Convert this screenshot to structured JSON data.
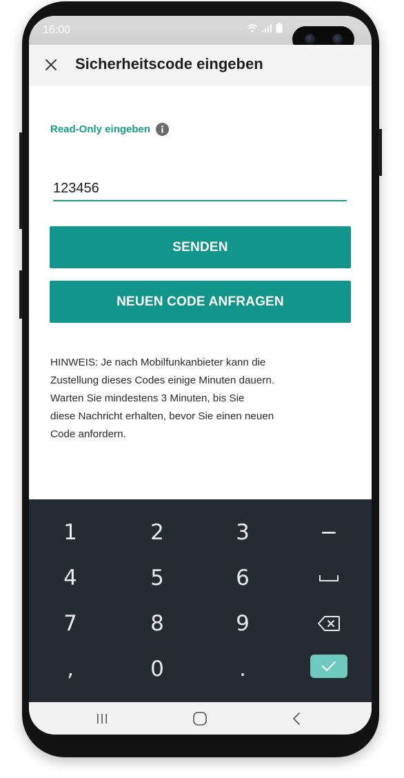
{
  "status_bar": {
    "time": "16:00",
    "icons": [
      "wifi-icon",
      "signal-icon",
      "battery-icon"
    ]
  },
  "app_bar": {
    "close_icon": "close-icon",
    "title": "Sicherheitscode eingeben"
  },
  "form": {
    "label": "Read-Only eingeben",
    "info_icon": "info-icon",
    "code_value": "123456",
    "send_label": "SENDEN",
    "new_code_label": "NEUEN CODE ANFRAGEN"
  },
  "note": {
    "lines": [
      "HINWEIS: Je nach Mobilfunkanbieter kann die",
      "Zustellung dieses Codes einige Minuten dauern.",
      "Warten Sie mindestens 3 Minuten, bis Sie",
      "diese Nachricht erhalten, bevor Sie einen neuen",
      "Code anfordern."
    ]
  },
  "keyboard": {
    "keys": [
      "1",
      "2",
      "3",
      "−",
      "4",
      "5",
      "6",
      "␣",
      "7",
      "8",
      "9",
      "⌫",
      ",",
      "0",
      ".",
      "✓"
    ],
    "key_icons": {
      "space": "space-icon",
      "backspace": "backspace-icon",
      "done": "check-icon"
    }
  },
  "nav_bar": {
    "icons": [
      "recent-apps-icon",
      "home-icon",
      "back-icon"
    ]
  },
  "colors": {
    "accent": "#12958a",
    "label_accent": "#1a9a8a",
    "keyboard_bg": "#252b33",
    "done_key": "#6fc9bf"
  }
}
